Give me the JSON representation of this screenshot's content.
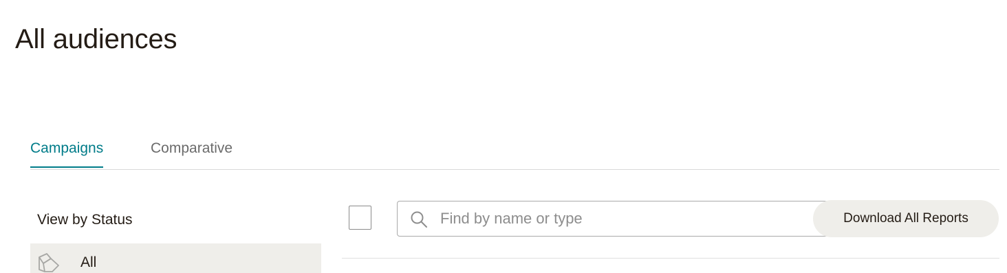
{
  "page": {
    "title": "All audiences"
  },
  "tabs": [
    {
      "label": "Campaigns",
      "active": true
    },
    {
      "label": "Comparative",
      "active": false
    }
  ],
  "sidebar": {
    "heading": "View by Status",
    "items": [
      {
        "label": "All",
        "icon": "all-campaigns-icon",
        "selected": true
      }
    ]
  },
  "toolbar": {
    "search_placeholder": "Find by name or type",
    "search_value": "",
    "download_label": "Download All Reports",
    "select_all_checked": false
  },
  "colors": {
    "accent": "#007c89",
    "text": "#241c15",
    "muted_text": "#6b6b6b",
    "button_bg": "#efeeea",
    "border": "#a9a9a9"
  }
}
